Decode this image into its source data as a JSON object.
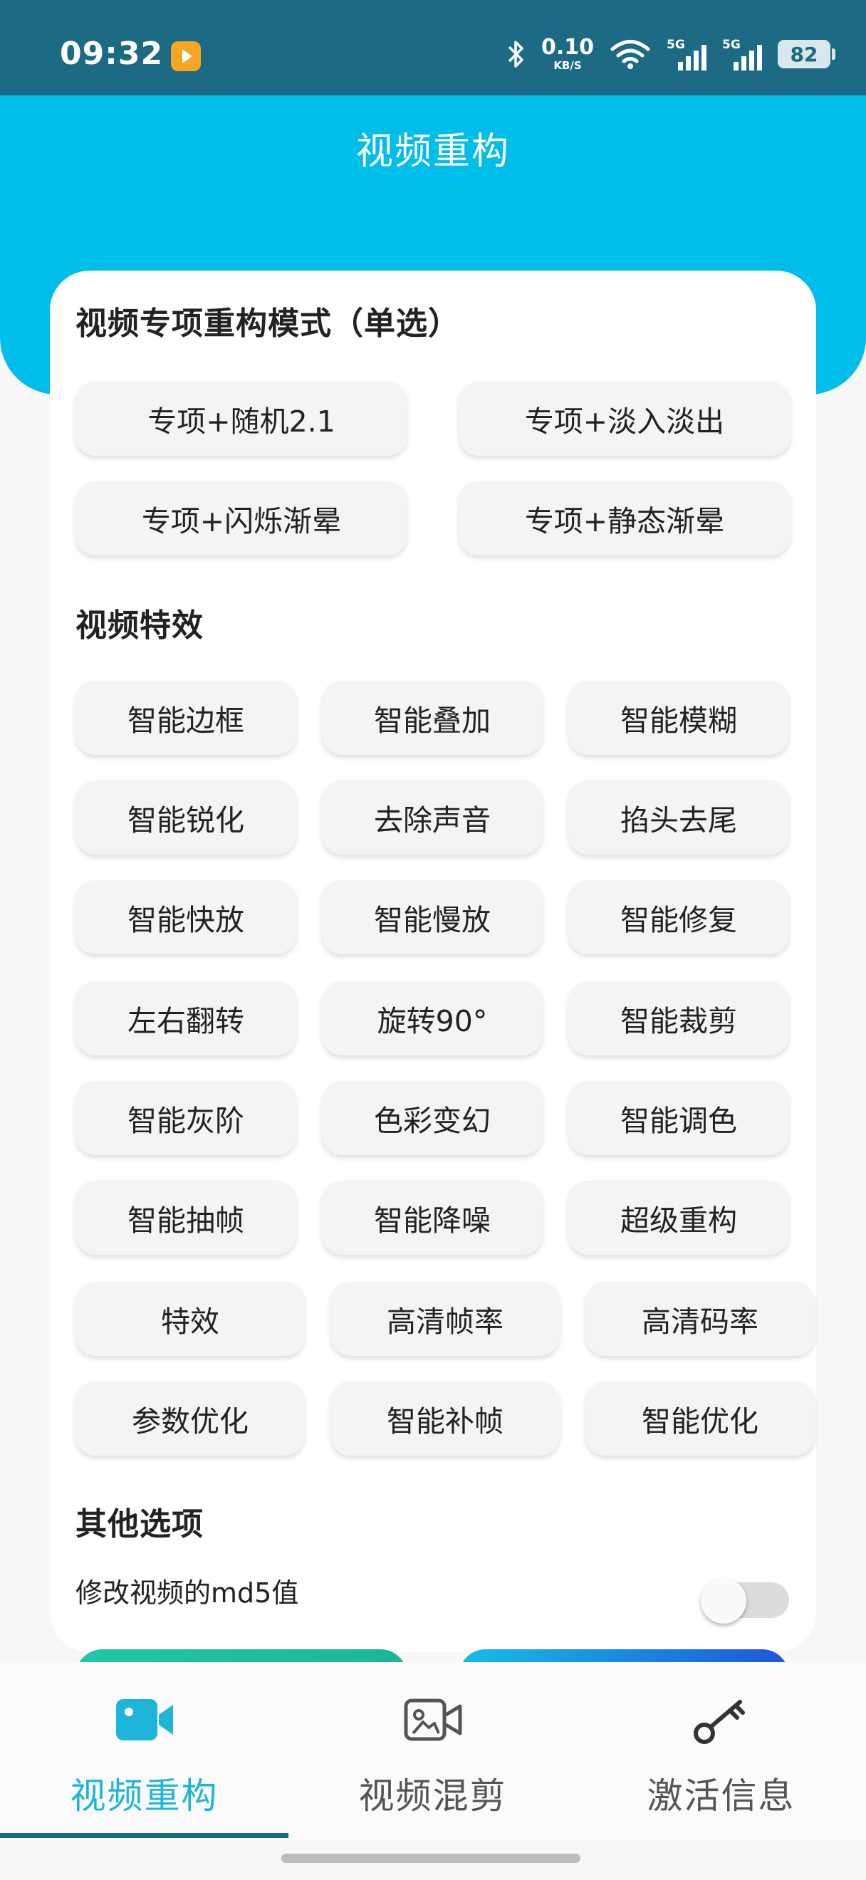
{
  "status_bar": {
    "time": "09:32",
    "net_speed": "0.10",
    "net_unit": "KB/S",
    "sim1_label": "5G",
    "sim2_label": "5G",
    "battery": "82",
    "icons": [
      "app-notification-icon",
      "bluetooth-icon",
      "wifi-icon",
      "signal-icon",
      "battery-icon"
    ]
  },
  "header": {
    "title": "视频重构"
  },
  "sections": {
    "mode_title": "视频专项重构模式（单选）",
    "mode_options": [
      "专项+随机2.1",
      "专项+淡入淡出",
      "专项+闪烁渐晕",
      "专项+静态渐晕"
    ],
    "effects_title": "视频特效",
    "effects": [
      "智能边框",
      "智能叠加",
      "智能模糊",
      "智能锐化",
      "去除声音",
      "掐头去尾",
      "智能快放",
      "智能慢放",
      "智能修复",
      "左右翻转",
      "旋转90°",
      "智能裁剪",
      "智能灰阶",
      "色彩变幻",
      "智能调色",
      "智能抽帧",
      "智能降噪",
      "超级重构",
      "特效",
      "高清帧率",
      "高清码率",
      "参数优化",
      "智能补帧",
      "智能优化"
    ],
    "other_title": "其他选项",
    "md5_label": "修改视频的md5值",
    "md5_toggle_on": false
  },
  "bottom_nav": {
    "items": [
      {
        "label": "视频重构",
        "icon": "video-camera-icon",
        "active": true
      },
      {
        "label": "视频混剪",
        "icon": "video-edit-icon",
        "active": false
      },
      {
        "label": "激活信息",
        "icon": "key-icon",
        "active": false
      }
    ]
  },
  "colors": {
    "status_bar": "#1d6a84",
    "header": "#00bde9",
    "active_tab": "#1fb5d8",
    "inactive_tab": "#555555",
    "chip_bg": "#f4f4f4"
  }
}
